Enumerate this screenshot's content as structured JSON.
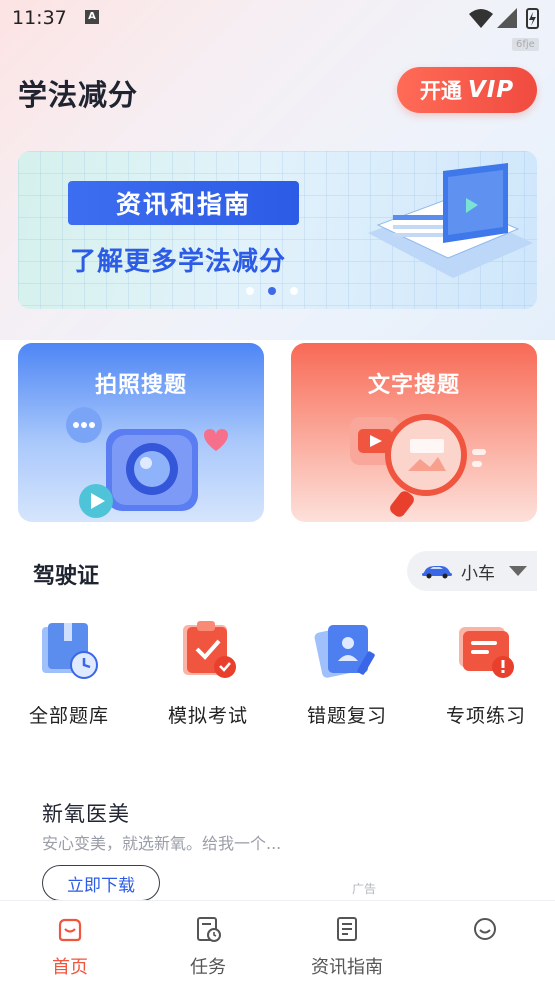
{
  "status_bar": {
    "time": "11:37",
    "notif_letter": "A"
  },
  "corner_tag": "6fje",
  "header": {
    "title": "学法减分",
    "vip_prefix": "开通",
    "vip_word": "VIP"
  },
  "banner": {
    "chip": "资讯和指南",
    "subtitle": "了解更多学法减分",
    "dots": 3,
    "active_dot": 2
  },
  "cards": [
    {
      "label": "拍照搜题"
    },
    {
      "label": "文字搜题"
    }
  ],
  "license": {
    "title": "驾驶证",
    "vehicle": "小车"
  },
  "features": [
    {
      "label": "全部题库",
      "icon": "question-bank-icon"
    },
    {
      "label": "模拟考试",
      "icon": "mock-exam-icon"
    },
    {
      "label": "错题复习",
      "icon": "mistake-review-icon"
    },
    {
      "label": "专项练习",
      "icon": "special-practice-icon"
    }
  ],
  "ad": {
    "title": "新氧医美",
    "description": "安心变美，就选新氧。给我一个...",
    "button": "立即下载",
    "tag": "广告"
  },
  "tabs": [
    {
      "label": "首页",
      "icon": "home-icon",
      "active": true
    },
    {
      "label": "任务",
      "icon": "task-icon",
      "active": false
    },
    {
      "label": "资讯指南",
      "icon": "news-guide-icon",
      "active": false
    },
    {
      "label": "",
      "icon": "profile-icon",
      "active": false
    }
  ],
  "colors": {
    "accent": "#f0553f",
    "primary_blue": "#2c5be6"
  }
}
